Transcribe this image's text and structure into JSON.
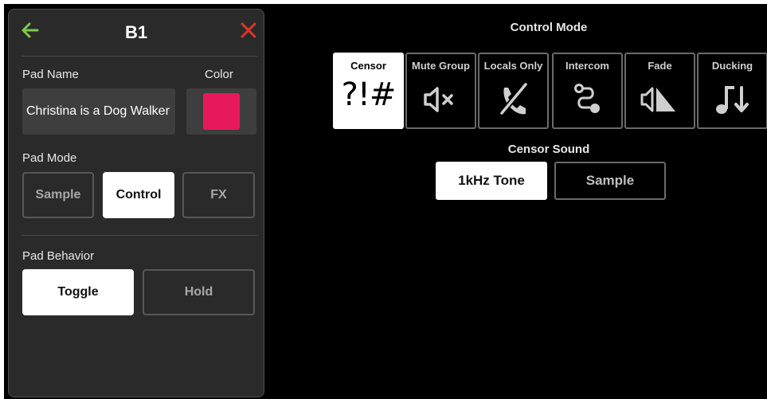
{
  "panel": {
    "title": "B1",
    "pad_name_label": "Pad Name",
    "pad_name_value": "Christina is a Dog Walker",
    "color_label": "Color",
    "color_value": "#e8195a",
    "pad_mode_label": "Pad Mode",
    "pad_modes": [
      "Sample",
      "Control",
      "FX"
    ],
    "pad_mode_selected": "Control",
    "pad_behavior_label": "Pad Behavior",
    "pad_behaviors": [
      "Toggle",
      "Hold"
    ],
    "pad_behavior_selected": "Toggle",
    "icons": {
      "back": "back-arrow-icon",
      "close": "close-icon"
    },
    "colors": {
      "back": "#7ec850",
      "close": "#e8302a"
    }
  },
  "control_mode": {
    "title": "Control Mode",
    "options": [
      {
        "label": "Censor",
        "glyph": "?!#",
        "icon": "censor-icon"
      },
      {
        "label": "Mute Group",
        "icon": "speaker-mute-icon"
      },
      {
        "label": "Locals Only",
        "icon": "phone-off-icon"
      },
      {
        "label": "Intercom",
        "icon": "intercom-route-icon"
      },
      {
        "label": "Fade",
        "icon": "fade-icon"
      },
      {
        "label": "Ducking",
        "icon": "ducking-icon"
      }
    ],
    "selected": "Censor"
  },
  "censor_sound": {
    "title": "Censor Sound",
    "options": [
      "1kHz Tone",
      "Sample"
    ],
    "selected": "1kHz Tone"
  }
}
